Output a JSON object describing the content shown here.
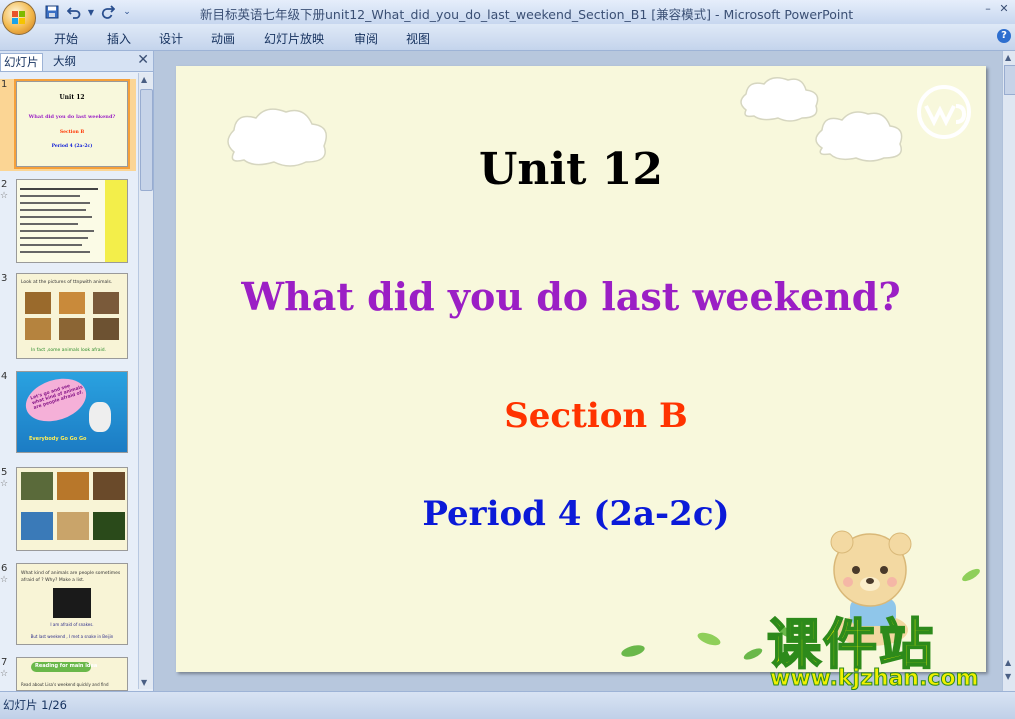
{
  "window": {
    "title": "新目标英语七年级下册unit12_What_did_you_do_last_weekend_Section_B1 [兼容模式] - Microsoft PowerPoint"
  },
  "quick_access": {
    "save_icon": "save-icon",
    "undo_icon": "undo-icon",
    "redo_icon": "redo-icon"
  },
  "menu": {
    "items": [
      "开始",
      "插入",
      "设计",
      "动画",
      "幻灯片放映",
      "审阅",
      "视图"
    ]
  },
  "panel": {
    "tabs": [
      "幻灯片",
      "大纲"
    ],
    "thumbnails": [
      {
        "num": "1",
        "lines": [
          "Unit 12",
          "What did you do last weekend?",
          "Section B",
          "Period 4 (2a-2c)"
        ]
      },
      {
        "num": "2"
      },
      {
        "num": "3",
        "lines": [
          "Look at the pictures of ttnpwith animals.",
          "In fact ,some animals look afraid."
        ]
      },
      {
        "num": "4",
        "lines": [
          "Let's go and see what kind of animals are people afraid of.",
          "Everybody Go Go Go"
        ]
      },
      {
        "num": "5"
      },
      {
        "num": "6",
        "lines": [
          "What kind of animals are people sometimes afraid of ? Why? Make a list.",
          "I am afraid of snakes.",
          "But last weekend , I met a snake in Beijin"
        ]
      },
      {
        "num": "7",
        "lines": [
          "Reading for main idea",
          "Read about Lisa's weekend quickly and find"
        ]
      }
    ]
  },
  "slide": {
    "title": "Unit 12",
    "subtitle": "What did you do last weekend?",
    "section": "Section B",
    "period": "Period 4 (2a-2c)",
    "colors": {
      "title": "#000000",
      "subtitle": "#9b1fc5",
      "section": "#ff3300",
      "period": "#0b1ad8",
      "background": "#f8f8dc"
    }
  },
  "watermark": {
    "chinese": "课件站",
    "url": "www.kjzhan.com"
  },
  "status": {
    "slide_indicator": "幻灯片 1/26"
  }
}
